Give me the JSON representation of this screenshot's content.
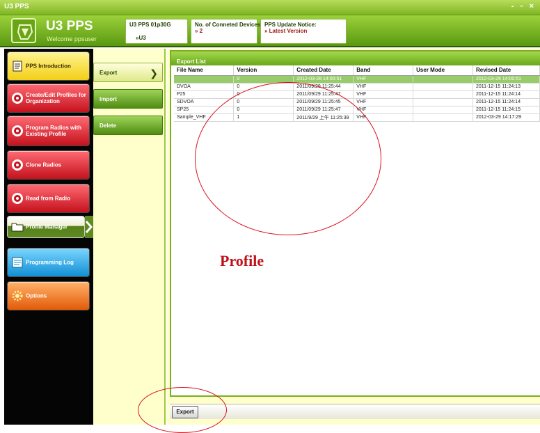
{
  "window": {
    "title": "U3 PPS",
    "controls": "- ▫ ×"
  },
  "header": {
    "app_name": "U3 PPS",
    "welcome": "Welcome ppsuser",
    "version_box": {
      "label": "U3 PPS 01p30G",
      "value": "»U3"
    },
    "devices_box": {
      "label": "No. of Conneted Devices:",
      "value": "» 2"
    },
    "update_box": {
      "label": "PPS Update Notice:",
      "value": "» Latest Version"
    }
  },
  "nav": {
    "items": [
      {
        "label": "PPS Introduction",
        "color": "yellow",
        "icon": "document-icon"
      },
      {
        "label": "Create/Edit Profiles for Organization",
        "color": "red",
        "icon": "radio-icon"
      },
      {
        "label": "Program Radios with Existing Profile",
        "color": "red",
        "icon": "radio-icon"
      },
      {
        "label": "Clone Radios",
        "color": "red",
        "icon": "radio-icon"
      },
      {
        "label": "Read from Radio",
        "color": "red",
        "icon": "radio-icon"
      },
      {
        "label": "Profile Manager",
        "color": "active",
        "icon": "folder-icon"
      },
      {
        "label": "Programming Log",
        "color": "blue",
        "icon": "log-icon"
      },
      {
        "label": "Options",
        "color": "orange",
        "icon": "gear-icon"
      }
    ]
  },
  "subnav": {
    "items": [
      {
        "label": "Export",
        "active": true
      },
      {
        "label": "Import",
        "active": false
      },
      {
        "label": "Delete",
        "active": false
      }
    ]
  },
  "export_list": {
    "title": "Export List",
    "columns": [
      "File Name",
      "Version",
      "Created Date",
      "Band",
      "User Mode",
      "Revised Date"
    ],
    "rows": [
      [
        "",
        "0",
        "2012-03-28 14:00:51",
        "VHF",
        "",
        "2012-03-29 14:00:51"
      ],
      [
        "DVOA",
        "0",
        "2011/09/29 11:25:44",
        "VHF",
        "",
        "2011-12-15 11:24:13"
      ],
      [
        "P25",
        "0",
        "2011/09/29 11:25:47",
        "VHF",
        "",
        "2011-12-15 11:24:14"
      ],
      [
        "SDVOA",
        "0",
        "2011/09/29 11:25:45",
        "VHF",
        "",
        "2011-12-15 11:24:14"
      ],
      [
        "SP25",
        "0",
        "2011/09/29 11:25:47",
        "VHF",
        "",
        "2011-12-15 11:24:15"
      ],
      [
        "Sample_VHF",
        "1",
        "2011/9/29 上午 11:25:39",
        "VHF",
        "",
        "2012-03-29 14:17:29"
      ]
    ]
  },
  "bottom": {
    "export_label": "Export"
  },
  "annotation": {
    "text": "Profile",
    "color": "#c0121b"
  },
  "colors": {
    "accent_green": "#7ab020",
    "selected_row": "#98cc6a",
    "content_bg": "#ffffcc"
  }
}
